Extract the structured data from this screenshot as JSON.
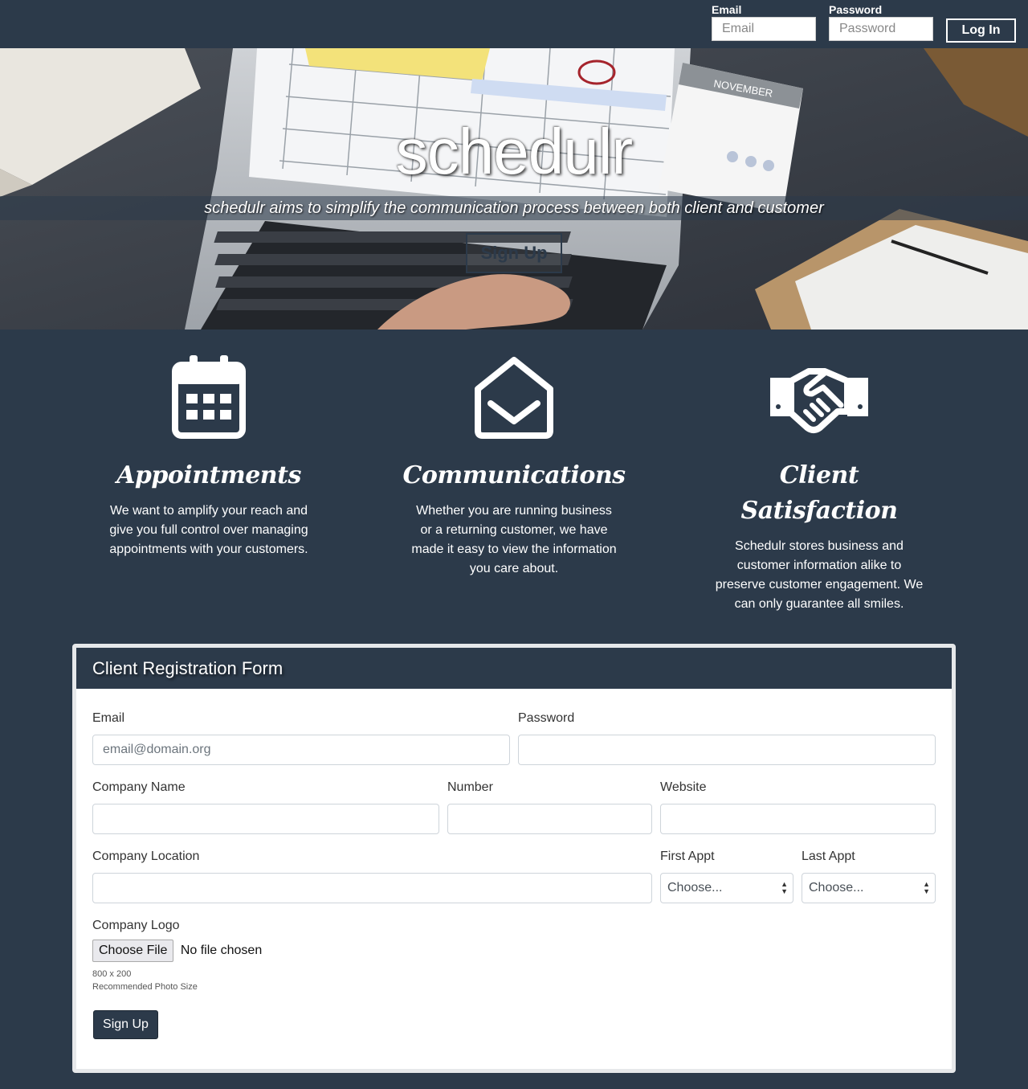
{
  "nav": {
    "email_label": "Email",
    "email_placeholder": "Email",
    "password_label": "Password",
    "password_placeholder": "Password",
    "login_label": "Log In"
  },
  "hero": {
    "title": "schedulr",
    "tagline": "schedulr aims to simplify the communication process between both client and customer",
    "signup_label": "Sign Up",
    "calendar_month": "NOVEMBER"
  },
  "features": [
    {
      "icon": "calendar-icon",
      "title": "Appointments",
      "description": "We want to amplify your reach and give you full control over managing appointments with your customers."
    },
    {
      "icon": "open-envelope-icon",
      "title": "Communications",
      "description": "Whether you are running business or a returning customer, we have made it easy to view the information you care about."
    },
    {
      "icon": "handshake-icon",
      "title": "Client Satisfaction",
      "description": "Schedulr stores business and customer information alike to preserve customer engagement. We can only guarantee all smiles."
    }
  ],
  "form": {
    "title": "Client Registration Form",
    "email_label": "Email",
    "email_placeholder": "email@domain.org",
    "password_label": "Password",
    "company_name_label": "Company Name",
    "number_label": "Number",
    "website_label": "Website",
    "company_location_label": "Company Location",
    "first_appt_label": "First Appt",
    "first_appt_value": "Choose...",
    "last_appt_label": "Last Appt",
    "last_appt_value": "Choose...",
    "company_logo_label": "Company Logo",
    "choose_file_label": "Choose File",
    "file_status": "No file chosen",
    "photo_size": "800 x 200",
    "photo_hint": "Recommended Photo Size",
    "submit_label": "Sign Up"
  },
  "colors": {
    "navy": "#2c3a4a",
    "white": "#ffffff",
    "card_border": "#e6e8ea"
  }
}
